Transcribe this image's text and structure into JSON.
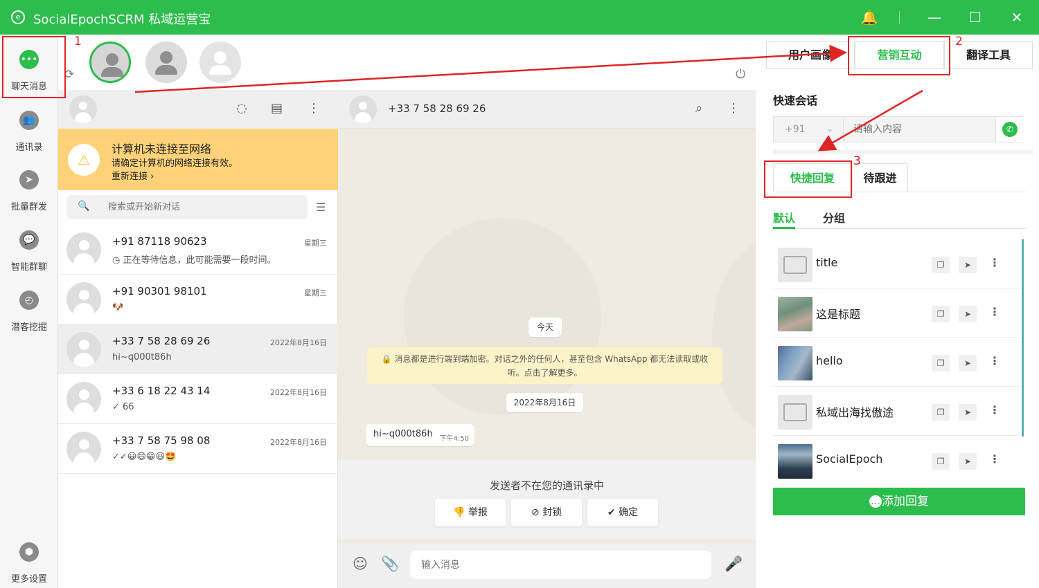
{
  "app": {
    "title": "SocialEpochSCRM 私域运营宝",
    "logo": "e"
  },
  "titlebar": {
    "bell_icon": "bell-icon",
    "minimize": "—",
    "maximize": "☐",
    "close": "✕"
  },
  "sidebar": {
    "items": [
      {
        "label": "聊天消息",
        "icon": "chat-bubble-icon"
      },
      {
        "label": "通讯录",
        "icon": "contacts-icon"
      },
      {
        "label": "批量群发",
        "icon": "send-icon"
      },
      {
        "label": "智能群聊",
        "icon": "group-chat-icon"
      },
      {
        "label": "潜客挖掘",
        "icon": "compass-icon"
      },
      {
        "label": "更多设置",
        "icon": "settings-icon"
      }
    ]
  },
  "chatlist": {
    "network_warning": {
      "title": "计算机未连接至网络",
      "message": "请确定计算机的网络连接有效。",
      "action": "重新连接 ›"
    },
    "search_placeholder": "搜索或开始新对话",
    "chats": [
      {
        "name": "+91 87118 90623",
        "time": "星期三",
        "preview": "◷ 正在等待信息，此可能需要一段时间。"
      },
      {
        "name": "+91 90301 98101",
        "time": "星期三",
        "preview": "🐶"
      },
      {
        "name": "+33 7 58 28 69 26",
        "time": "2022年8月16日",
        "preview": "hi~q000t86h"
      },
      {
        "name": "+33 6 18 22 43 14",
        "time": "2022年8月16日",
        "preview": "✓ 66"
      },
      {
        "name": "+33 7 58 75 98 08",
        "time": "2022年8月16日",
        "preview": "✓✓😀😄😁😆🤩"
      }
    ]
  },
  "conversation": {
    "contact": "+33 7 58 28 69 26",
    "today_pill": "今天",
    "encryption_notice": "🔒 消息都是进行端到端加密。对话之外的任何人，甚至包含 WhatsApp 都无法读取或收听。点击了解更多。",
    "date_pill": "2022年8月16日",
    "message": {
      "text": "hi~q000t86h",
      "time": "下午4:50"
    },
    "unknown_sender": {
      "text": "发送者不在您的通讯录中",
      "buttons": [
        "举报",
        "封锁",
        "确定"
      ]
    },
    "composer_placeholder": "输入消息"
  },
  "rightpanel": {
    "tabs": [
      "用户画像",
      "营销互动",
      "翻译工具"
    ],
    "section_title": "快速会话",
    "country_code": "+91",
    "input_placeholder": "请输入内容",
    "subtabs": [
      "快捷回复",
      "待跟进"
    ],
    "groups": [
      "默认",
      "分组"
    ],
    "replies": [
      {
        "title": "title"
      },
      {
        "title": "这是标题"
      },
      {
        "title": "hello"
      },
      {
        "title": "私域出海找傲途"
      },
      {
        "title": "SocialEpoch"
      }
    ],
    "add_button": "添加回复"
  },
  "annotations": [
    "1",
    "2",
    "3"
  ],
  "colors": {
    "accent": "#2cbd4c",
    "warning": "#ffd279",
    "annotation": "#e02424"
  }
}
